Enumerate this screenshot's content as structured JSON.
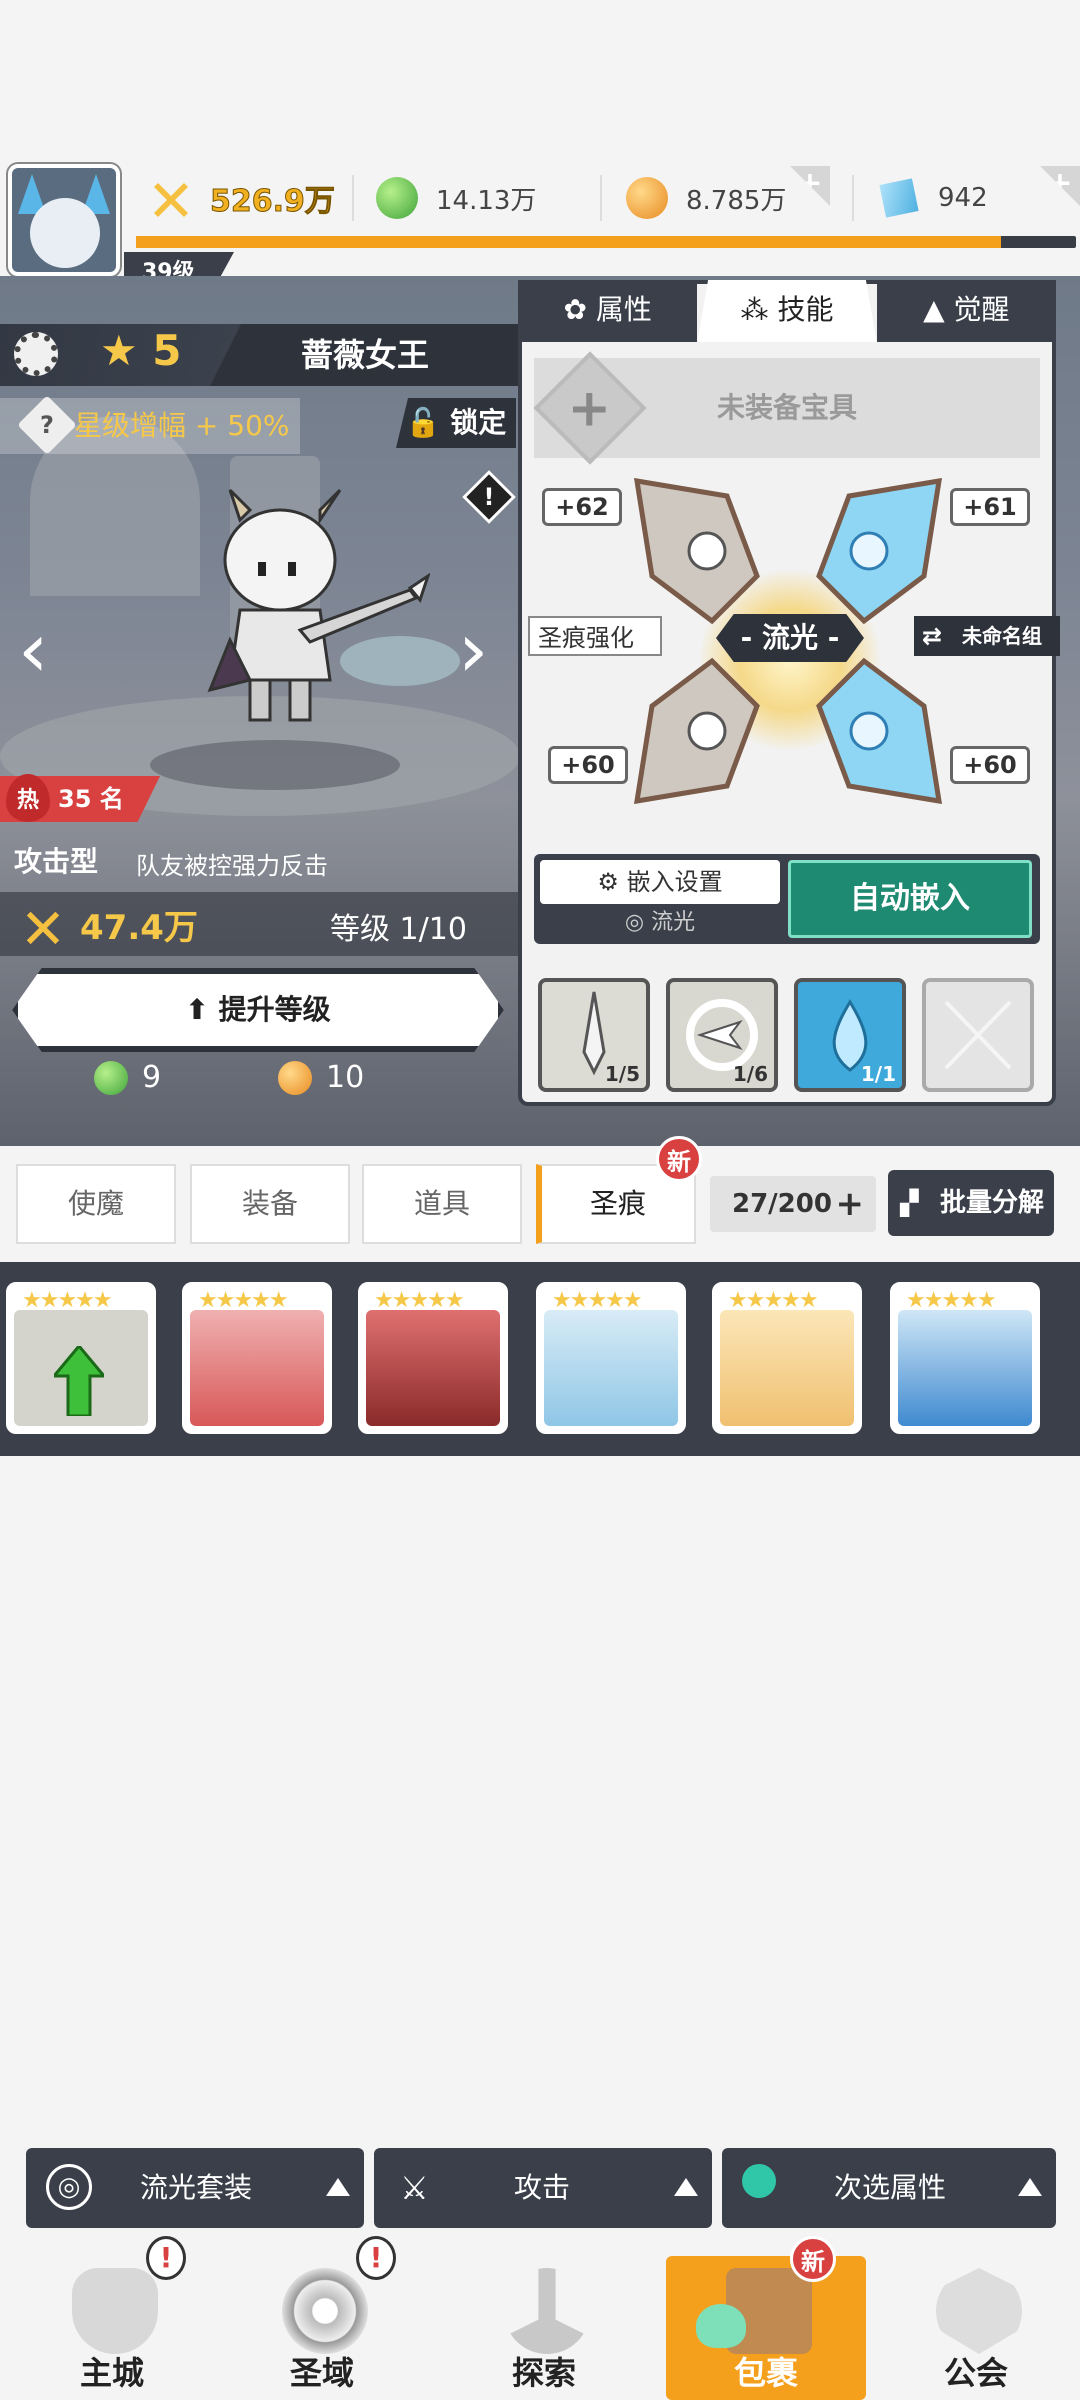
{
  "resources": {
    "power": "526.9万",
    "green_orb": "14.13万",
    "gold_coin": "8.785万",
    "diamond": "942",
    "player_level": "39级",
    "exp_progress": 0.92
  },
  "hero": {
    "stars": "5",
    "name": "蔷薇女王",
    "star_bonus": "星级增幅 + 50%",
    "lock_label": "锁定",
    "hot_label": "热",
    "rank": "35 名",
    "type": "攻击型",
    "type_desc": "队友被控强力反击",
    "power": "47.4万",
    "level": "等级 1/10",
    "upgrade_label": "提升等级",
    "cost_green": "9",
    "cost_gold": "10"
  },
  "panel": {
    "tabs": [
      {
        "label": "属性"
      },
      {
        "label": "技能"
      },
      {
        "label": "觉醒"
      }
    ],
    "artifact_label": "未装备宝具",
    "slot_values": [
      "+62",
      "+61",
      "+60",
      "+60"
    ],
    "center_label": "- 流光 -",
    "left_label": "圣痕强化",
    "right_label": "未命名组",
    "embed_settings": "嵌入设置",
    "embed_sub": "流光",
    "auto_embed": "自动嵌入",
    "skills": [
      {
        "count": "1/5"
      },
      {
        "count": "1/6"
      },
      {
        "count": "1/1"
      }
    ]
  },
  "filter_tabs": [
    "使魔",
    "装备",
    "道具",
    "圣痕"
  ],
  "new_badge": "新",
  "capacity": "27/200",
  "batch_label": "批量分解",
  "stars_text": "★★★★★",
  "bottom_filters": {
    "set": "流光套装",
    "attack": "攻击",
    "secondary": "次选属性"
  },
  "nav": [
    {
      "label": "主城"
    },
    {
      "label": "圣域"
    },
    {
      "label": "探索"
    },
    {
      "label": "包裹"
    },
    {
      "label": "公会"
    }
  ],
  "colors": {
    "accent": "#f5a01d",
    "dark": "#3a3f4a",
    "teal": "#1e8a72",
    "hot": "#d94040",
    "star": "#f6c84a"
  }
}
